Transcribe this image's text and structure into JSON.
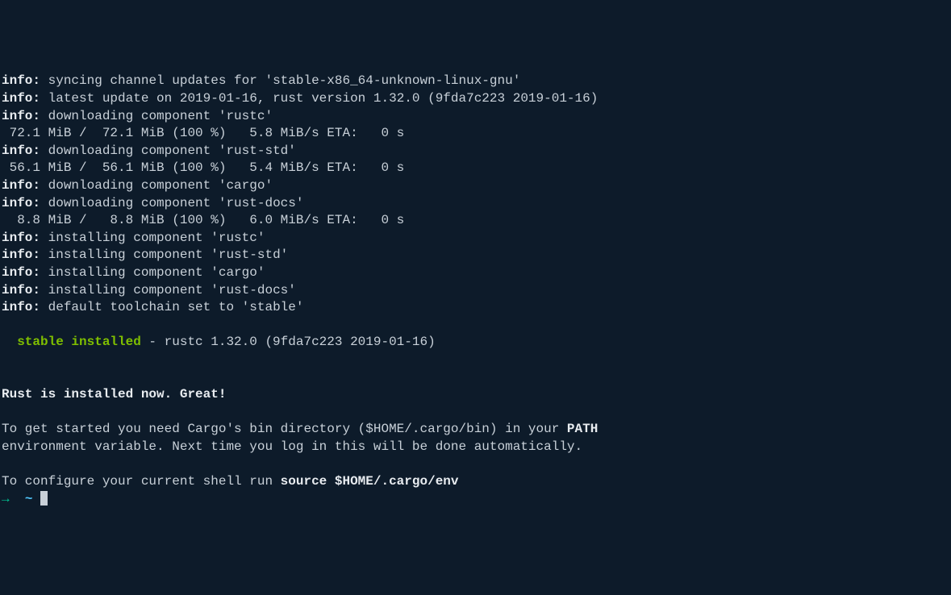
{
  "lines": [
    {
      "type": "info",
      "label": "info:",
      "text": " syncing channel updates for 'stable-x86_64-unknown-linux-gnu'"
    },
    {
      "type": "info",
      "label": "info:",
      "text": " latest update on 2019-01-16, rust version 1.32.0 (9fda7c223 2019-01-16)"
    },
    {
      "type": "info",
      "label": "info:",
      "text": " downloading component 'rustc'"
    },
    {
      "type": "plain",
      "text": " 72.1 MiB /  72.1 MiB (100 %)   5.8 MiB/s ETA:   0 s"
    },
    {
      "type": "info",
      "label": "info:",
      "text": " downloading component 'rust-std'"
    },
    {
      "type": "plain",
      "text": " 56.1 MiB /  56.1 MiB (100 %)   5.4 MiB/s ETA:   0 s"
    },
    {
      "type": "info",
      "label": "info:",
      "text": " downloading component 'cargo'"
    },
    {
      "type": "info",
      "label": "info:",
      "text": " downloading component 'rust-docs'"
    },
    {
      "type": "plain",
      "text": "  8.8 MiB /   8.8 MiB (100 %)   6.0 MiB/s ETA:   0 s"
    },
    {
      "type": "info",
      "label": "info:",
      "text": " installing component 'rustc'"
    },
    {
      "type": "info",
      "label": "info:",
      "text": " installing component 'rust-std'"
    },
    {
      "type": "info",
      "label": "info:",
      "text": " installing component 'cargo'"
    },
    {
      "type": "info",
      "label": "info:",
      "text": " installing component 'rust-docs'"
    },
    {
      "type": "info",
      "label": "info:",
      "text": " default toolchain set to 'stable'"
    }
  ],
  "status": {
    "prefix": "  ",
    "green": "stable installed",
    "rest": " - rustc 1.32.0 (9fda7c223 2019-01-16)"
  },
  "completion": {
    "bold_msg": "Rust is installed now. Great!",
    "path_line_pre": "To get started you need Cargo's bin directory ($HOME/.cargo/bin) in your ",
    "path_line_bold": "PATH",
    "env_line": "environment variable. Next time you log in this will be done automatically.",
    "configure_pre": "To configure your current shell run ",
    "configure_bold": "source $HOME/.cargo/env"
  },
  "prompt": {
    "arrow": "→",
    "tilde": "~"
  }
}
